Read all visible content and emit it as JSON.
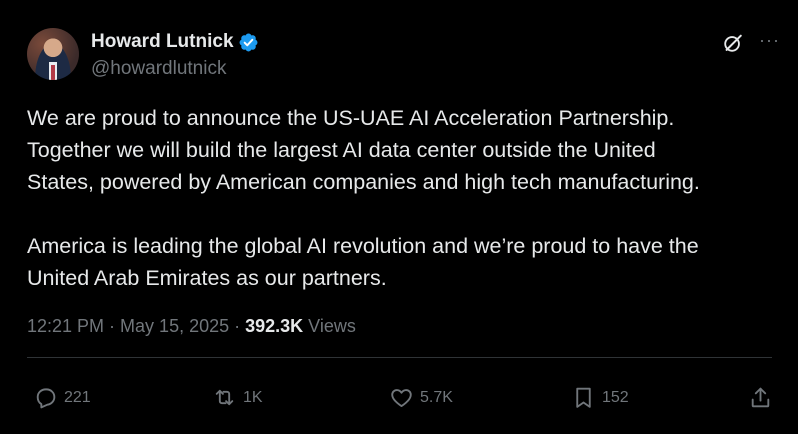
{
  "author": {
    "name": "Howard Lutnick",
    "handle": "@howardlutnick",
    "verified": true
  },
  "tweet": {
    "paragraphs": [
      "We are proud to announce the US-UAE AI Acceleration Partnership.\nTogether we will build the largest AI data center outside the United\nStates, powered by American companies and high tech manufacturing.",
      "America is leading the global AI revolution and we’re proud to have the\nUnited Arab Emirates as our partners."
    ],
    "time": "12:21 PM",
    "separator": "·",
    "date": "May 15, 2025",
    "views_count": "392.3K",
    "views_label": "Views"
  },
  "actions": {
    "replies": "221",
    "reposts": "1K",
    "likes": "5.7K",
    "bookmarks": "152"
  },
  "header_icons": {
    "grok": "grok-icon",
    "more": "···"
  },
  "colors": {
    "background": "#000000",
    "text": "#e7e9ea",
    "muted": "#71767b",
    "verified": "#1d9bf0",
    "divider": "#2f3336"
  }
}
